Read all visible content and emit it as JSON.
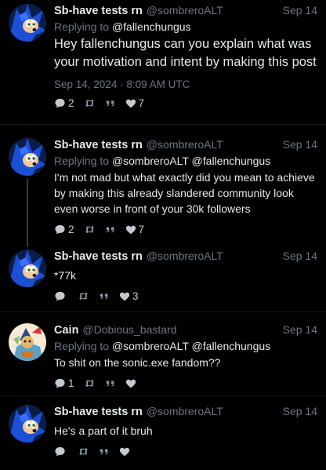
{
  "tweets": [
    {
      "name": "Sb-have tests rn",
      "handle": "@sombreroALT",
      "date": "Sep 14",
      "replying_prefix": "Replying to ",
      "replying_to": "@fallenchungus",
      "text": "Hey fallenchungus can you explain what was your motivation and intent by making this post",
      "timestamp": "Sep 14, 2024 · 8:09 AM UTC",
      "replies": "2",
      "retweets": "",
      "quotes": "",
      "likes": "7"
    },
    {
      "name": "Sb-have tests rn",
      "handle": "@sombreroALT",
      "date": "Sep 14",
      "replying_prefix": "Replying to ",
      "replying_to": "@sombreroALT @fallenchungus",
      "text": "I'm not mad but what exactly did you mean to achieve by making this already slandered community look even worse in front of your 30k followers",
      "replies": "2",
      "retweets": "",
      "quotes": "",
      "likes": "7"
    },
    {
      "name": "Sb-have tests rn",
      "handle": "@sombreroALT",
      "date": "Sep 14",
      "text": "*77k",
      "replies": "",
      "retweets": "",
      "quotes": "",
      "likes": "3"
    },
    {
      "name": "Cain",
      "handle": "@Dobious_bastard",
      "date": "Sep 14",
      "replying_prefix": "Replying to ",
      "replying_to": "@sombreroALT @fallenchungus",
      "text": "To shit on the sonic.exe fandom??",
      "replies": "1",
      "retweets": "",
      "quotes": "",
      "likes": ""
    },
    {
      "name": "Sb-have tests rn",
      "handle": "@sombreroALT",
      "date": "Sep 14",
      "text": "He's a part of it bruh",
      "replies": "",
      "retweets": "",
      "quotes": "",
      "likes": ""
    }
  ],
  "icons": {
    "reply": "speech-bubble-icon",
    "retweet": "retweet-icon",
    "quote": "quote-icon",
    "like": "heart-icon"
  },
  "colors": {
    "background": "#000000",
    "text": "#e7e9ea",
    "muted": "#6e767d"
  }
}
